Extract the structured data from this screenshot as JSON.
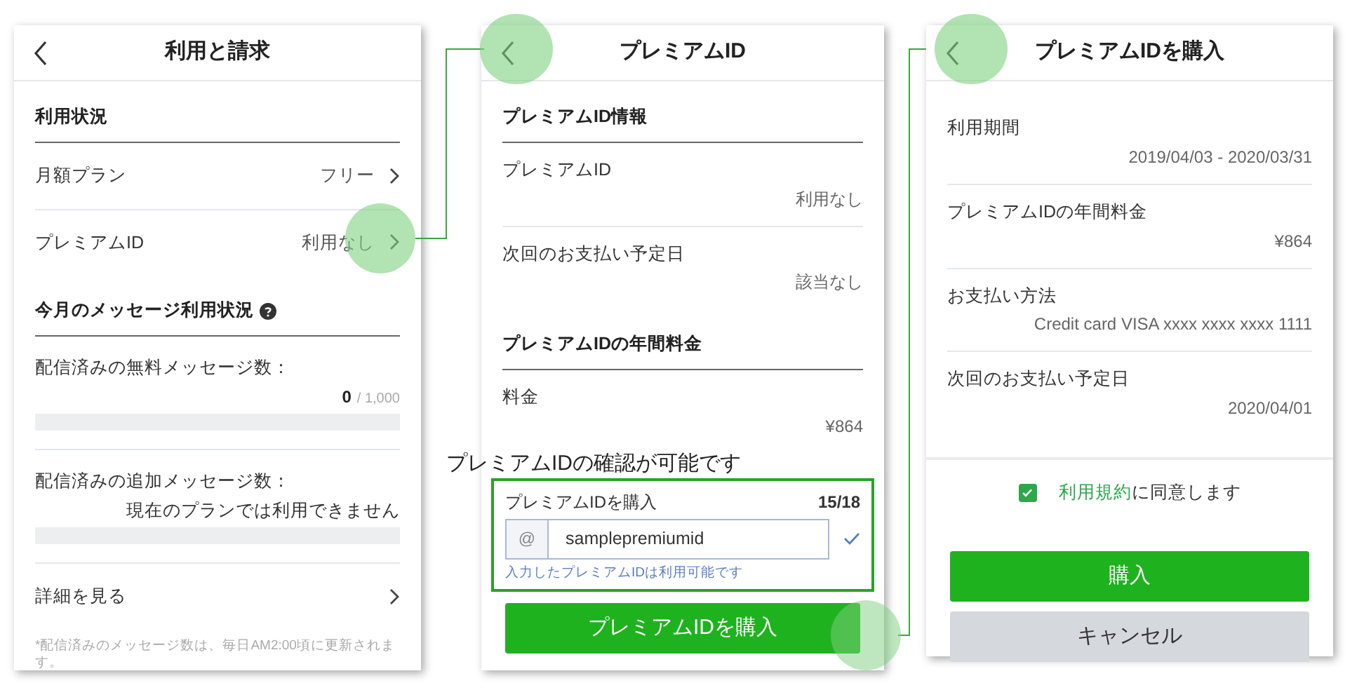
{
  "screens": [
    {
      "title": "利用と請求",
      "rows": [
        {
          "kind": "section",
          "label": "利用状況"
        },
        {
          "kind": "nav",
          "label": "月額プラン",
          "value": "フリー"
        },
        {
          "kind": "nav",
          "label": "プレミアムID",
          "value": "利用なし"
        },
        {
          "kind": "section",
          "label": "今月のメッセージ利用状況",
          "help": true
        },
        {
          "kind": "meter",
          "label": "配信済みの無料メッセージ数：",
          "count": "0",
          "limit": "/ 1,000"
        },
        {
          "kind": "meter",
          "label": "配信済みの追加メッセージ数：",
          "reading": "現在のプランでは利用できません"
        },
        {
          "kind": "nav",
          "label": "詳細を見る"
        },
        {
          "kind": "note",
          "text": "*配信済みのメッセージ数は、毎日AM2:00頃に更新されます。"
        }
      ]
    },
    {
      "title": "プレミアムID",
      "rows": [
        {
          "kind": "section",
          "label": "プレミアムID情報"
        },
        {
          "kind": "detail",
          "label": "プレミアムID",
          "value": "利用なし"
        },
        {
          "kind": "detail",
          "label": "次回のお支払い予定日",
          "value": "該当なし"
        },
        {
          "kind": "section",
          "label": "プレミアムIDの年間料金"
        },
        {
          "kind": "detail",
          "label": "料金",
          "value": "¥864"
        },
        {
          "kind": "id_field",
          "label": "プレミアムIDを購入",
          "counter": "15/18",
          "prefix": "@",
          "value": "samplepremiumid",
          "valid": true,
          "hint": "入力したプレミアムIDは利用可能です"
        },
        {
          "kind": "primary_button",
          "label": "プレミアムIDを購入"
        }
      ]
    },
    {
      "title": "プレミアムIDを購入",
      "rows": [
        {
          "kind": "detail",
          "label": "利用期間",
          "value": "2019/04/03 - 2020/03/31"
        },
        {
          "kind": "detail",
          "label": "プレミアムIDの年間料金",
          "value": "¥864"
        },
        {
          "kind": "detail",
          "label": "お支払い方法",
          "value": "Credit card VISA xxxx xxxx xxxx 1111"
        },
        {
          "kind": "detail",
          "label": "次回のお支払い予定日",
          "value": "2020/04/01"
        },
        {
          "kind": "agree",
          "checked": true,
          "link": "利用規約",
          "text": "に同意します"
        },
        {
          "kind": "primary_button",
          "label": "購入"
        },
        {
          "kind": "cancel_button",
          "label": "キャンセル"
        }
      ]
    }
  ],
  "annotation": {
    "text": "プレミアムIDの確認が可能です"
  }
}
